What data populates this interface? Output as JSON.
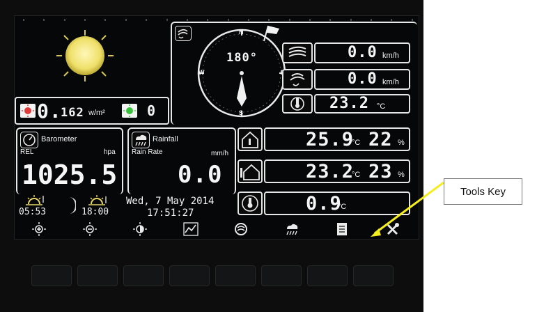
{
  "solar": {
    "value": "0.",
    "digits": "162",
    "unit": "w/m²",
    "uv_value": "0"
  },
  "wind": {
    "direction": "180°",
    "compass_n": "N",
    "compass_s": "S",
    "compass_e": "E",
    "compass_w": "W",
    "speed": "0.0",
    "speed_unit": "km/h",
    "gust": "0.0",
    "gust_unit": "km/h",
    "temp": "23.2",
    "temp_unit": "°C"
  },
  "barometer": {
    "title": "Barometer",
    "rel_label": "REL",
    "unit": "hpa",
    "value": "1025.5"
  },
  "rainfall": {
    "title": "Rainfall",
    "rate_label": "Rain Rate",
    "unit": "mm/h",
    "value": "0.0"
  },
  "indoor": {
    "temp": "25.9",
    "temp_unit": "°C",
    "humidity": "22",
    "humidity_unit": "%"
  },
  "outdoor": {
    "temp": "23.2",
    "temp_unit": "°C",
    "humidity": "23",
    "humidity_unit": "%"
  },
  "dewpoint": {
    "temp": "0.9",
    "temp_unit": "°C"
  },
  "sun": {
    "sunrise": "05:53",
    "sunset": "18:00"
  },
  "datetime": {
    "date": "Wed, 7 May 2014",
    "time": "17:51:27"
  },
  "toolbar": {
    "icons": [
      "brightness-up-icon",
      "brightness-down-icon",
      "contrast-icon",
      "graph-icon",
      "wind-icon",
      "rain-icon",
      "record-icon",
      "tools-icon"
    ]
  },
  "callout": {
    "label": "Tools Key"
  },
  "colors": {
    "arrow": "#f5ee1f",
    "screen": "#050708",
    "sun": "#f1e36a"
  }
}
